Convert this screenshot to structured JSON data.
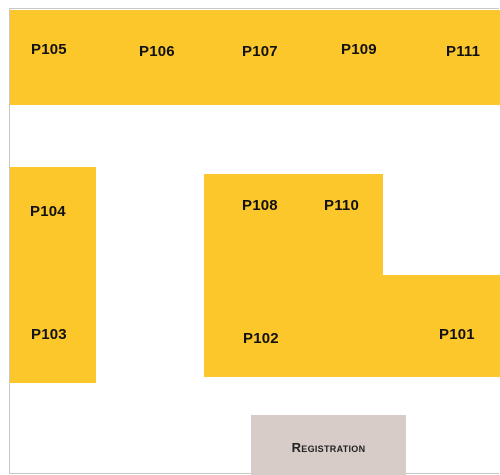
{
  "colors": {
    "booth_fill": "#fcc72a",
    "registration_fill": "#d7ccc7",
    "frame_border": "#c8c8c8",
    "background": "#ffffff"
  },
  "booths": {
    "p101": "P101",
    "p102": "P102",
    "p103": "P103",
    "p104": "P104",
    "p105": "P105",
    "p106": "P106",
    "p107": "P107",
    "p108": "P108",
    "p109": "P109",
    "p110": "P110",
    "p111": "P111"
  },
  "registration": {
    "label": "Registration"
  }
}
